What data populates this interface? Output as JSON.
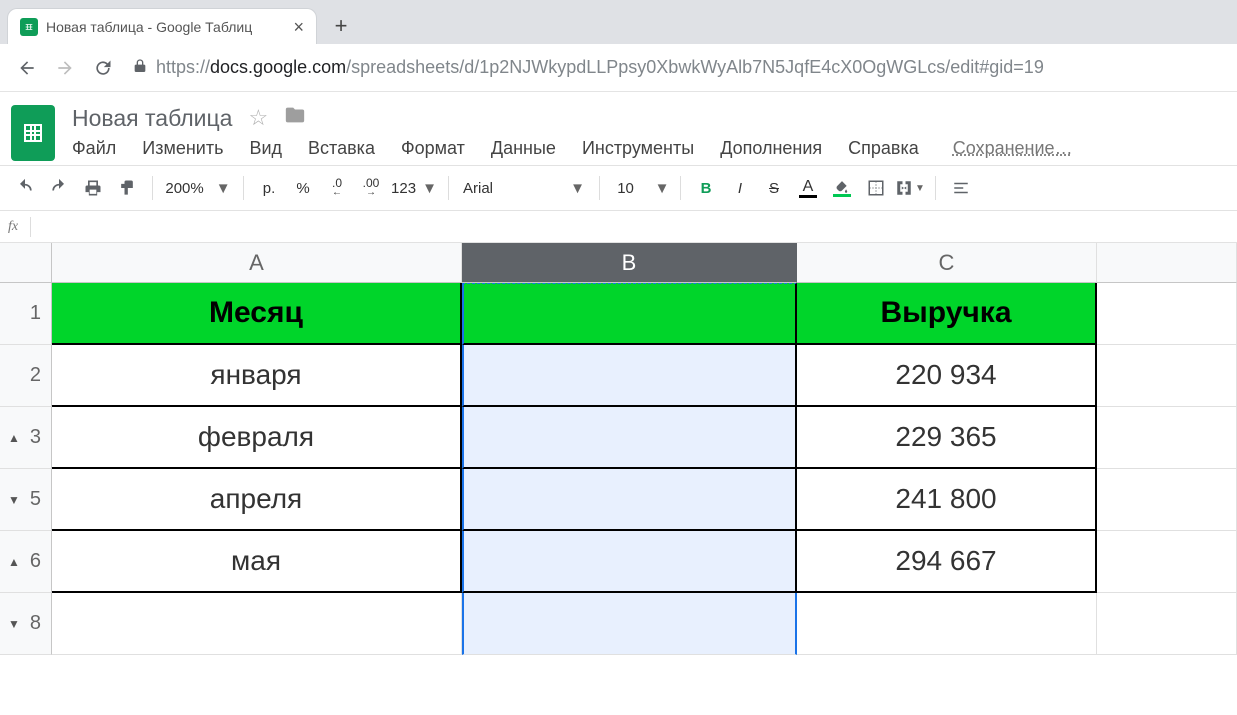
{
  "browser": {
    "tab_title": "Новая таблица - Google Таблиц",
    "url_proto": "https://",
    "url_host": "docs.google.com",
    "url_path": "/spreadsheets/d/1p2NJWkypdLLPpsy0XbwkWyAlb7N5JqfE4cX0OgWGLcs/edit#gid=19"
  },
  "sheet": {
    "title": "Новая таблица",
    "saving": "Сохранение…"
  },
  "menu": {
    "file": "Файл",
    "edit": "Изменить",
    "view": "Вид",
    "insert": "Вставка",
    "format": "Формат",
    "data": "Данные",
    "tools": "Инструменты",
    "addons": "Дополнения",
    "help": "Справка"
  },
  "toolbar": {
    "zoom": "200%",
    "currency": "р.",
    "percent": "%",
    "dec_dec": ".0",
    "inc_dec": ".00",
    "numfmt": "123",
    "font": "Arial",
    "font_size": "10",
    "bold": "В",
    "italic": "I",
    "strike": "S",
    "textcolor": "A"
  },
  "fx": {
    "label": "fx"
  },
  "grid": {
    "cols": {
      "A": "A",
      "B": "B",
      "C": "C"
    },
    "selected_col": "B",
    "row_labels": [
      "1",
      "2",
      "3",
      "5",
      "6",
      "8"
    ],
    "row_markers": [
      "",
      "",
      "up",
      "down",
      "up",
      "down"
    ],
    "rows": [
      {
        "A": "Месяц",
        "B": "",
        "C": "Выручка"
      },
      {
        "A": "января",
        "B": "",
        "C": "220 934"
      },
      {
        "A": "февраля",
        "B": "",
        "C": "229 365"
      },
      {
        "A": "апреля",
        "B": "",
        "C": "241 800"
      },
      {
        "A": "мая",
        "B": "",
        "C": "294 667"
      },
      {
        "A": "",
        "B": "",
        "C": ""
      }
    ]
  }
}
